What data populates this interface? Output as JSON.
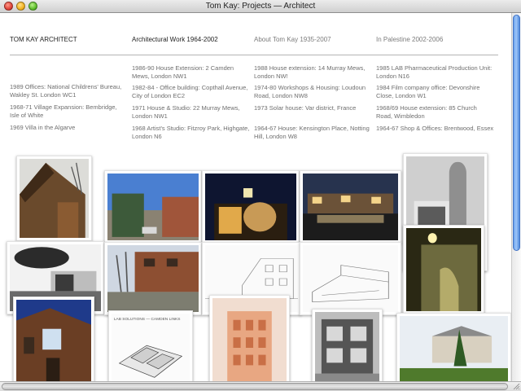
{
  "window": {
    "title": "Tom Kay: Projects — Architect"
  },
  "nav": {
    "home": "TOM KAY ARCHITECT",
    "work": "Architectural Work 1964-2002",
    "about": "About Tom Kay 1935-2007",
    "palestine": "In Palestine 2002-2006"
  },
  "projects": {
    "col1": [
      "1989 Offices: National Childrens' Bureau, Wakley St. London WC1",
      "1968-71 Village Expansion: Bembridge, Isle of White",
      "1969 Villa in the Algarve"
    ],
    "col2": [
      "1986-90 House Extension: 2 Camden Mews, London NW1",
      "1982-84 - Office building: Copthall Avenue, City of London EC2",
      "1971 House & Studio: 22 Murray Mews, London NW1",
      "1968 Artist's Studio: Fitzroy Park, Highgate, London N6"
    ],
    "col3": [
      "1988 House extension: 14 Murray Mews, London NW!",
      "1974-80 Workshops & Housing: Loudoun Road, London NW8",
      "1973 Solar house: Var district, France",
      "1964-67 House: Kensington Place, Notting Hill, London W8"
    ],
    "col4": [
      "1985 LAB Pharmaceutical Production Unit: London N16",
      "1984 Film company office: Devonshire Close, London W1",
      "1968/69 House extension: 85 Church Road, Wimbledon",
      "1964-67 Shop & Offices: Brentwood, Essex"
    ]
  },
  "photos": {
    "plan_caption": "LAB SOLUTIONS — CAMDEN LINKS"
  }
}
